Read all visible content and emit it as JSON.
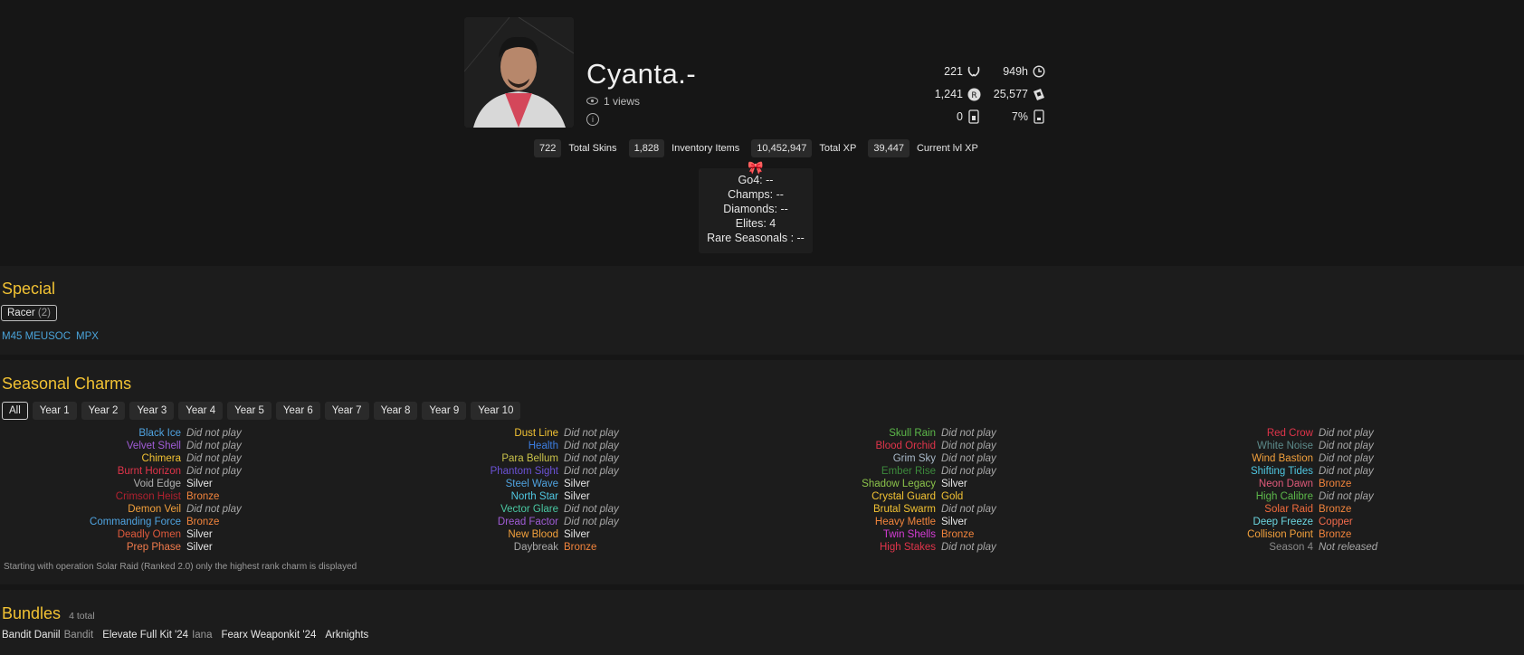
{
  "profile": {
    "name": "Cyanta.-",
    "views": "1 views"
  },
  "stats": {
    "level": "221",
    "hours": "949h",
    "credits": "1,241",
    "renown": "25,577",
    "packs": "0",
    "pack_chance": "7%"
  },
  "badges": [
    {
      "num": "722",
      "label": "Total Skins"
    },
    {
      "num": "1,828",
      "label": "Inventory Items"
    },
    {
      "num": "10,452,947",
      "label": "Total XP"
    },
    {
      "num": "39,447",
      "label": "Current lvl XP"
    }
  ],
  "ranks": {
    "go4": "Go4: --",
    "champs": "Champs: --",
    "diamonds": "Diamonds: --",
    "elites": "Elites: 4",
    "rare": "Rare Seasonals : --"
  },
  "special": {
    "title": "Special",
    "pill_label": "Racer",
    "pill_count": "(2)",
    "items": [
      "M45 MEUSOC",
      "MPX"
    ]
  },
  "seasonal": {
    "title": "Seasonal Charms",
    "years": [
      "All",
      "Year 1",
      "Year 2",
      "Year 3",
      "Year 4",
      "Year 5",
      "Year 6",
      "Year 7",
      "Year 8",
      "Year 9",
      "Year 10"
    ],
    "columns": [
      [
        {
          "name": "Black Ice",
          "value": "Did not play",
          "color": "#4fa3e0"
        },
        {
          "name": "Velvet Shell",
          "value": "Did not play",
          "color": "#a05cd6"
        },
        {
          "name": "Chimera",
          "value": "Did not play",
          "color": "#f2c233"
        },
        {
          "name": "Burnt Horizon",
          "value": "Did not play",
          "color": "#e0344a"
        },
        {
          "name": "Void Edge",
          "value": "Silver",
          "color": "#b0b0b0"
        },
        {
          "name": "Crimson Heist",
          "value": "Bronze",
          "color": "#b0212f"
        },
        {
          "name": "Demon Veil",
          "value": "Did not play",
          "color": "#f2a03c"
        },
        {
          "name": "Commanding Force",
          "value": "Bronze",
          "color": "#4fa3e0"
        },
        {
          "name": "Deadly Omen",
          "value": "Silver",
          "color": "#e05a3c"
        },
        {
          "name": "Prep Phase",
          "value": "Silver",
          "color": "#f27b4c"
        }
      ],
      [
        {
          "name": "Dust Line",
          "value": "Did not play",
          "color": "#f2c233"
        },
        {
          "name": "Health",
          "value": "Did not play",
          "color": "#3c7de0"
        },
        {
          "name": "Para Bellum",
          "value": "Did not play",
          "color": "#c9c24a"
        },
        {
          "name": "Phantom Sight",
          "value": "Did not play",
          "color": "#6b52d6"
        },
        {
          "name": "Steel Wave",
          "value": "Silver",
          "color": "#4fa3e0"
        },
        {
          "name": "North Star",
          "value": "Silver",
          "color": "#4fc6e0"
        },
        {
          "name": "Vector Glare",
          "value": "Did not play",
          "color": "#4ac9a3"
        },
        {
          "name": "Dread Factor",
          "value": "Did not play",
          "color": "#a05cd6"
        },
        {
          "name": "New Blood",
          "value": "Silver",
          "color": "#f2a03c"
        },
        {
          "name": "Daybreak",
          "value": "Bronze",
          "color": "#a8a8a8"
        }
      ],
      [
        {
          "name": "Skull Rain",
          "value": "Did not play",
          "color": "#5cb84a"
        },
        {
          "name": "Blood Orchid",
          "value": "Did not play",
          "color": "#e0344a"
        },
        {
          "name": "Grim Sky",
          "value": "Did not play",
          "color": "#a8b8c8"
        },
        {
          "name": "Ember Rise",
          "value": "Did not play",
          "color": "#3c8a3c"
        },
        {
          "name": "Shadow Legacy",
          "value": "Silver",
          "color": "#8bc34a"
        },
        {
          "name": "Crystal Guard",
          "value": "Gold",
          "color": "#f2c233"
        },
        {
          "name": "Brutal Swarm",
          "value": "Did not play",
          "color": "#f2c233"
        },
        {
          "name": "Heavy Mettle",
          "value": "Silver",
          "color": "#f2843c"
        },
        {
          "name": "Twin Shells",
          "value": "Bronze",
          "color": "#d63cd6"
        },
        {
          "name": "High Stakes",
          "value": "Did not play",
          "color": "#e0344a"
        }
      ],
      [
        {
          "name": "Red Crow",
          "value": "Did not play",
          "color": "#e0344a"
        },
        {
          "name": "White Noise",
          "value": "Did not play",
          "color": "#5c8a8a"
        },
        {
          "name": "Wind Bastion",
          "value": "Did not play",
          "color": "#f2a03c"
        },
        {
          "name": "Shifting Tides",
          "value": "Did not play",
          "color": "#4fc6e0"
        },
        {
          "name": "Neon Dawn",
          "value": "Bronze",
          "color": "#e05a7a"
        },
        {
          "name": "High Calibre",
          "value": "Did not play",
          "color": "#5cb84a"
        },
        {
          "name": "Solar Raid",
          "value": "Bronze",
          "color": "#f26b3c"
        },
        {
          "name": "Deep Freeze",
          "value": "Copper",
          "color": "#6bd6e0"
        },
        {
          "name": "Collision Point",
          "value": "Bronze",
          "color": "#f2a03c"
        },
        {
          "name": "Season 4",
          "value": "Not released",
          "color": "#8a8a8a"
        }
      ]
    ],
    "note": "Starting with operation Solar Raid (Ranked 2.0) only the highest rank charm is displayed"
  },
  "bundles": {
    "title": "Bundles",
    "total": "4 total",
    "items": [
      {
        "name": "Bandit Daniil",
        "sub": "Bandit"
      },
      {
        "name": "Elevate Full Kit '24",
        "sub": "Iana"
      },
      {
        "name": "Fearx Weaponkit '24",
        "sub": ""
      },
      {
        "name": "Arknights",
        "sub": ""
      }
    ]
  },
  "value_colors": {
    "Silver": "#e6e6e6",
    "Bronze": "#f2843c",
    "Gold": "#f2c233",
    "Copper": "#f26b4c"
  }
}
